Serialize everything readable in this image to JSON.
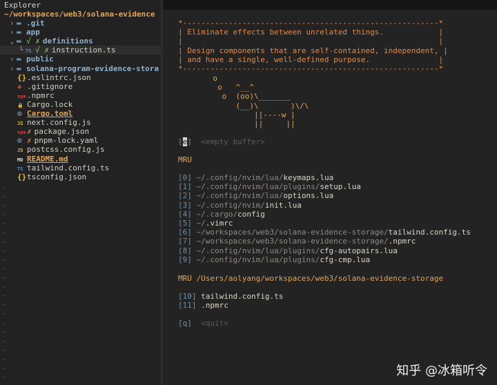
{
  "explorer": {
    "title": "Explorer",
    "root": "~/workspaces/web3/solana-evidence",
    "items": [
      {
        "chevron": "›",
        "icon": "▬",
        "git": "",
        "name": ".git",
        "type": "dir"
      },
      {
        "chevron": "›",
        "icon": "▬",
        "git": "",
        "name": "app",
        "type": "dir"
      },
      {
        "chevron": "⌄",
        "icon": "▬",
        "git": "√ ✗",
        "name": "definitions",
        "type": "dir"
      },
      {
        "chevron": "└",
        "icon": "TS",
        "git": "√ ✗",
        "name": "instruction.ts",
        "type": "file"
      },
      {
        "chevron": "›",
        "icon": "▬",
        "git": "",
        "name": "public",
        "type": "dir"
      },
      {
        "chevron": "›",
        "icon": "▬",
        "git": "",
        "name": "solana-program-evidence-stora",
        "type": "dir"
      },
      {
        "chevron": "",
        "icon": "{}",
        "git": "",
        "name": ".eslintrc.json",
        "type": "file"
      },
      {
        "chevron": "",
        "icon": "◈",
        "git": "",
        "name": ".gitignore",
        "type": "file"
      },
      {
        "chevron": "",
        "icon": "npm",
        "git": "",
        "name": ".npmrc",
        "type": "file"
      },
      {
        "chevron": "",
        "icon": "🔒",
        "git": "",
        "name": "Cargo.lock",
        "type": "file"
      },
      {
        "chevron": "",
        "icon": "⚙",
        "git": "",
        "name": "Cargo.toml",
        "type": "file"
      },
      {
        "chevron": "",
        "icon": "JS",
        "git": "",
        "name": "next.config.js",
        "type": "file"
      },
      {
        "chevron": "",
        "icon": "npm",
        "git": "✗",
        "name": "package.json",
        "type": "file"
      },
      {
        "chevron": "",
        "icon": "⚙",
        "git": "✗",
        "name": "pnpm-lock.yaml",
        "type": "file"
      },
      {
        "chevron": "",
        "icon": "JS",
        "git": "",
        "name": "postcss.config.js",
        "type": "file"
      },
      {
        "chevron": "",
        "icon": "MD",
        "git": "",
        "name": "README.md",
        "type": "file"
      },
      {
        "chevron": "",
        "icon": "TS",
        "git": "",
        "name": "tailwind.config.ts",
        "type": "file"
      },
      {
        "chevron": "",
        "icon": "{}",
        "git": "",
        "name": "tsconfig.json",
        "type": "file"
      }
    ]
  },
  "dashboard": {
    "quote_lines": [
      "*--------------------------------------------------------*",
      "| Eliminate effects between unrelated things.            |",
      "|                                                        |",
      "| Design components that are self-contained, independent, |",
      "| and have a single, well-defined purpose.               |",
      "*--------------------------------------------------------*"
    ],
    "cow_lines": [
      "       o",
      "        o   ^__^",
      "         o  (oo)\\_______",
      "            (__)\\       )\\/\\",
      "                ||----w |",
      "                ||     ||"
    ],
    "empty_buffer": {
      "key": "e",
      "label": "<empty buffer>"
    },
    "mru_title": "MRU",
    "mru": [
      {
        "idx": "[0]",
        "dir": "~/.config/nvim/lua/",
        "file": "keymaps.lua"
      },
      {
        "idx": "[1]",
        "dir": "~/.config/nvim/lua/plugins/",
        "file": "setup.lua"
      },
      {
        "idx": "[2]",
        "dir": "~/.config/nvim/lua/",
        "file": "options.lua"
      },
      {
        "idx": "[3]",
        "dir": "~/.config/nvim/",
        "file": "init.lua"
      },
      {
        "idx": "[4]",
        "dir": "~/.cargo/",
        "file": "config"
      },
      {
        "idx": "[5]",
        "dir": "~/",
        "file": ".vimrc"
      },
      {
        "idx": "[6]",
        "dir": "~/workspaces/web3/solana-evidence-storage/",
        "file": "tailwind.config.ts"
      },
      {
        "idx": "[7]",
        "dir": "~/workspaces/web3/solana-evidence-storage/",
        "file": ".npmrc"
      },
      {
        "idx": "[8]",
        "dir": "~/.config/nvim/lua/plugins/",
        "file": "cfg-autopairs.lua"
      },
      {
        "idx": "[9]",
        "dir": "~/.config/nvim/lua/plugins/",
        "file": "cfg-cmp.lua"
      }
    ],
    "mru_dir_title": "MRU /Users/aolyang/workspaces/web3/solana-evidence-storage",
    "mru_dir": [
      {
        "idx": "[10]",
        "file": "tailwind.config.ts"
      },
      {
        "idx": "[11]",
        "file": ".npmrc"
      }
    ],
    "quit": {
      "idx": "[q]",
      "label": "<quit>"
    }
  },
  "watermark": "知乎 @冰箱听令",
  "colors": {
    "accent": "#e08a4a",
    "folder": "#8fb2d0",
    "index": "#6f8fa6"
  }
}
